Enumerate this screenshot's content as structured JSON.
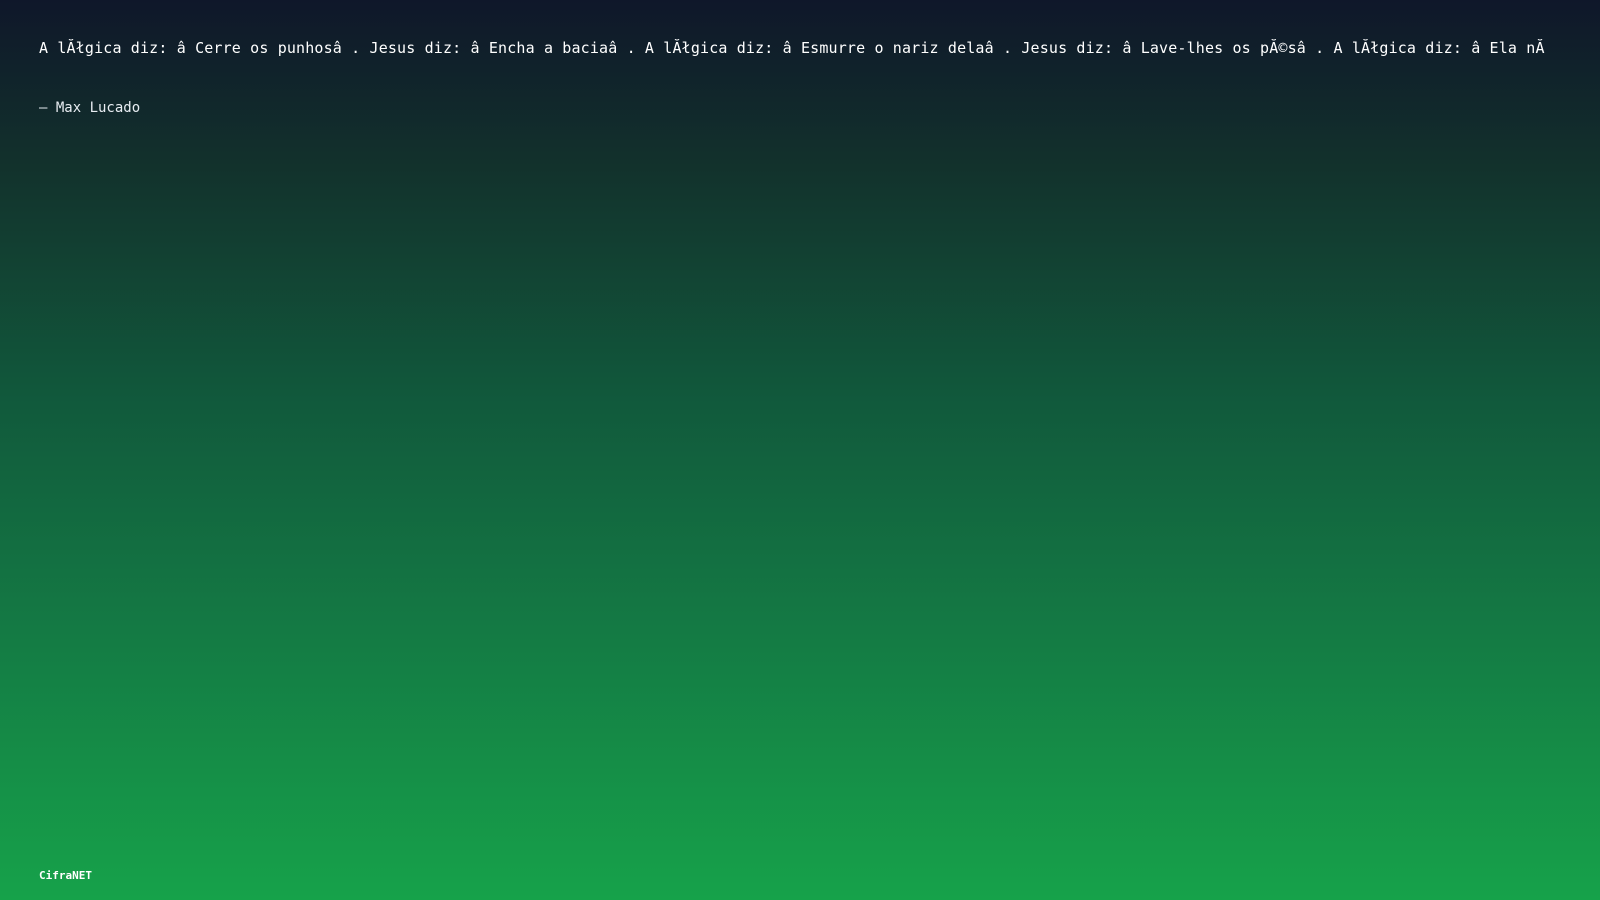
{
  "quote": {
    "text": "A lĂłgica diz: â  Cerre os punhosâ  . Jesus diz: â  Encha a baciaâ  . A lĂłgica diz: â  Esmurre o nariz delaâ  . Jesus diz: â  Lave-lhes os pĂ©sâ  . A lĂłgica diz: â  Ela nĂ",
    "author": "– Max Lucado"
  },
  "brand": {
    "name": "CifraNET"
  },
  "colors": {
    "background_top": "#0f172a",
    "background_bottom": "#16a24a",
    "text": "#ffffff"
  }
}
